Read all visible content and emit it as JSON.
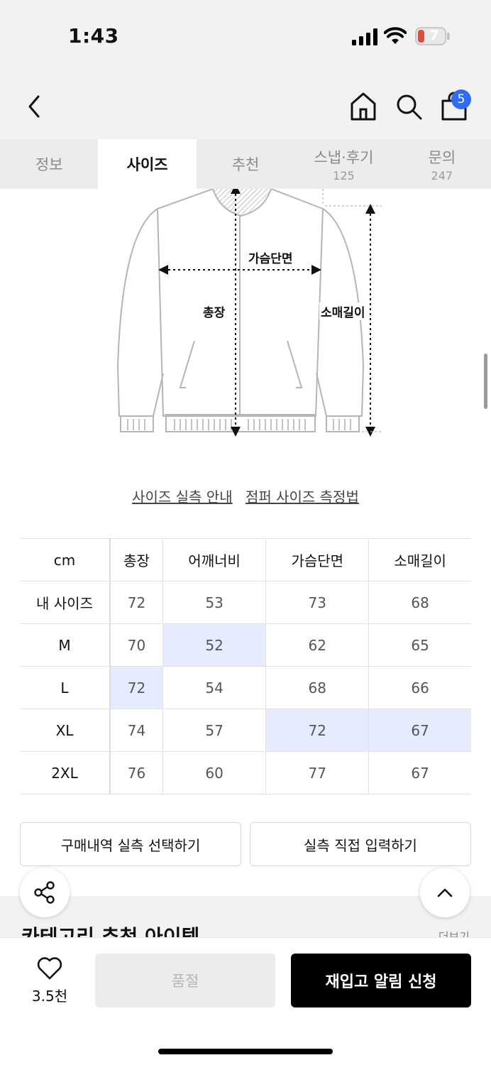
{
  "status": {
    "time": "1:43",
    "battery": "7"
  },
  "header": {
    "cart_count": "5"
  },
  "tabs": [
    {
      "label": "정보",
      "count": ""
    },
    {
      "label": "사이즈",
      "count": ""
    },
    {
      "label": "추천",
      "count": ""
    },
    {
      "label": "스냅·후기",
      "count": "125"
    },
    {
      "label": "문의",
      "count": "247"
    }
  ],
  "illustration": {
    "chest": "가슴단면",
    "length": "총장",
    "sleeve": "소매길이"
  },
  "links": {
    "guide": "사이즈 실측 안내",
    "method": "점퍼 사이즈 측정법"
  },
  "size_table": {
    "headers": [
      "cm",
      "총장",
      "어깨너비",
      "가슴단면",
      "소매길이"
    ],
    "rows": [
      [
        "내 사이즈",
        "72",
        "53",
        "73",
        "68"
      ],
      [
        "M",
        "70",
        "52",
        "62",
        "65"
      ],
      [
        "L",
        "72",
        "54",
        "68",
        "66"
      ],
      [
        "XL",
        "74",
        "57",
        "72",
        "67"
      ],
      [
        "2XL",
        "76",
        "60",
        "77",
        "67"
      ]
    ]
  },
  "buttons": {
    "history": "구매내역 실측 선택하기",
    "manual": "실측 직접 입력하기"
  },
  "section": {
    "title": "카테고리 추천 아이템",
    "more": "더보기"
  },
  "bottom": {
    "likes": "3.5천",
    "soldout": "품절",
    "restock": "재입고 알림 신청"
  }
}
